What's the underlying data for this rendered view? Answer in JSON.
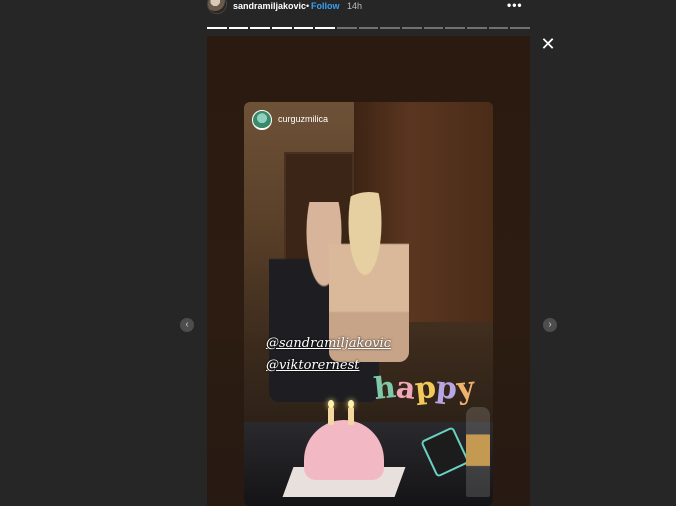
{
  "header": {
    "username": "sandramiljakovic",
    "separator": "•",
    "follow_label": "Follow",
    "time": "14h",
    "more_label": "•••"
  },
  "progress": {
    "total_segments": 15,
    "completed_segments": 6
  },
  "close_label": "✕",
  "story": {
    "repost_username": "curguzmilica",
    "mentions": [
      "@sandramiljakovic",
      "@viktorernest"
    ],
    "sticker_text": [
      "h",
      "a",
      "p",
      "p",
      "y"
    ],
    "sticker_colors": [
      "#7fc8a9",
      "#f0a7b8",
      "#f3c95a",
      "#b7a6e3",
      "#f0b36e"
    ]
  },
  "nav": {
    "prev_label": "‹",
    "next_label": "›"
  }
}
